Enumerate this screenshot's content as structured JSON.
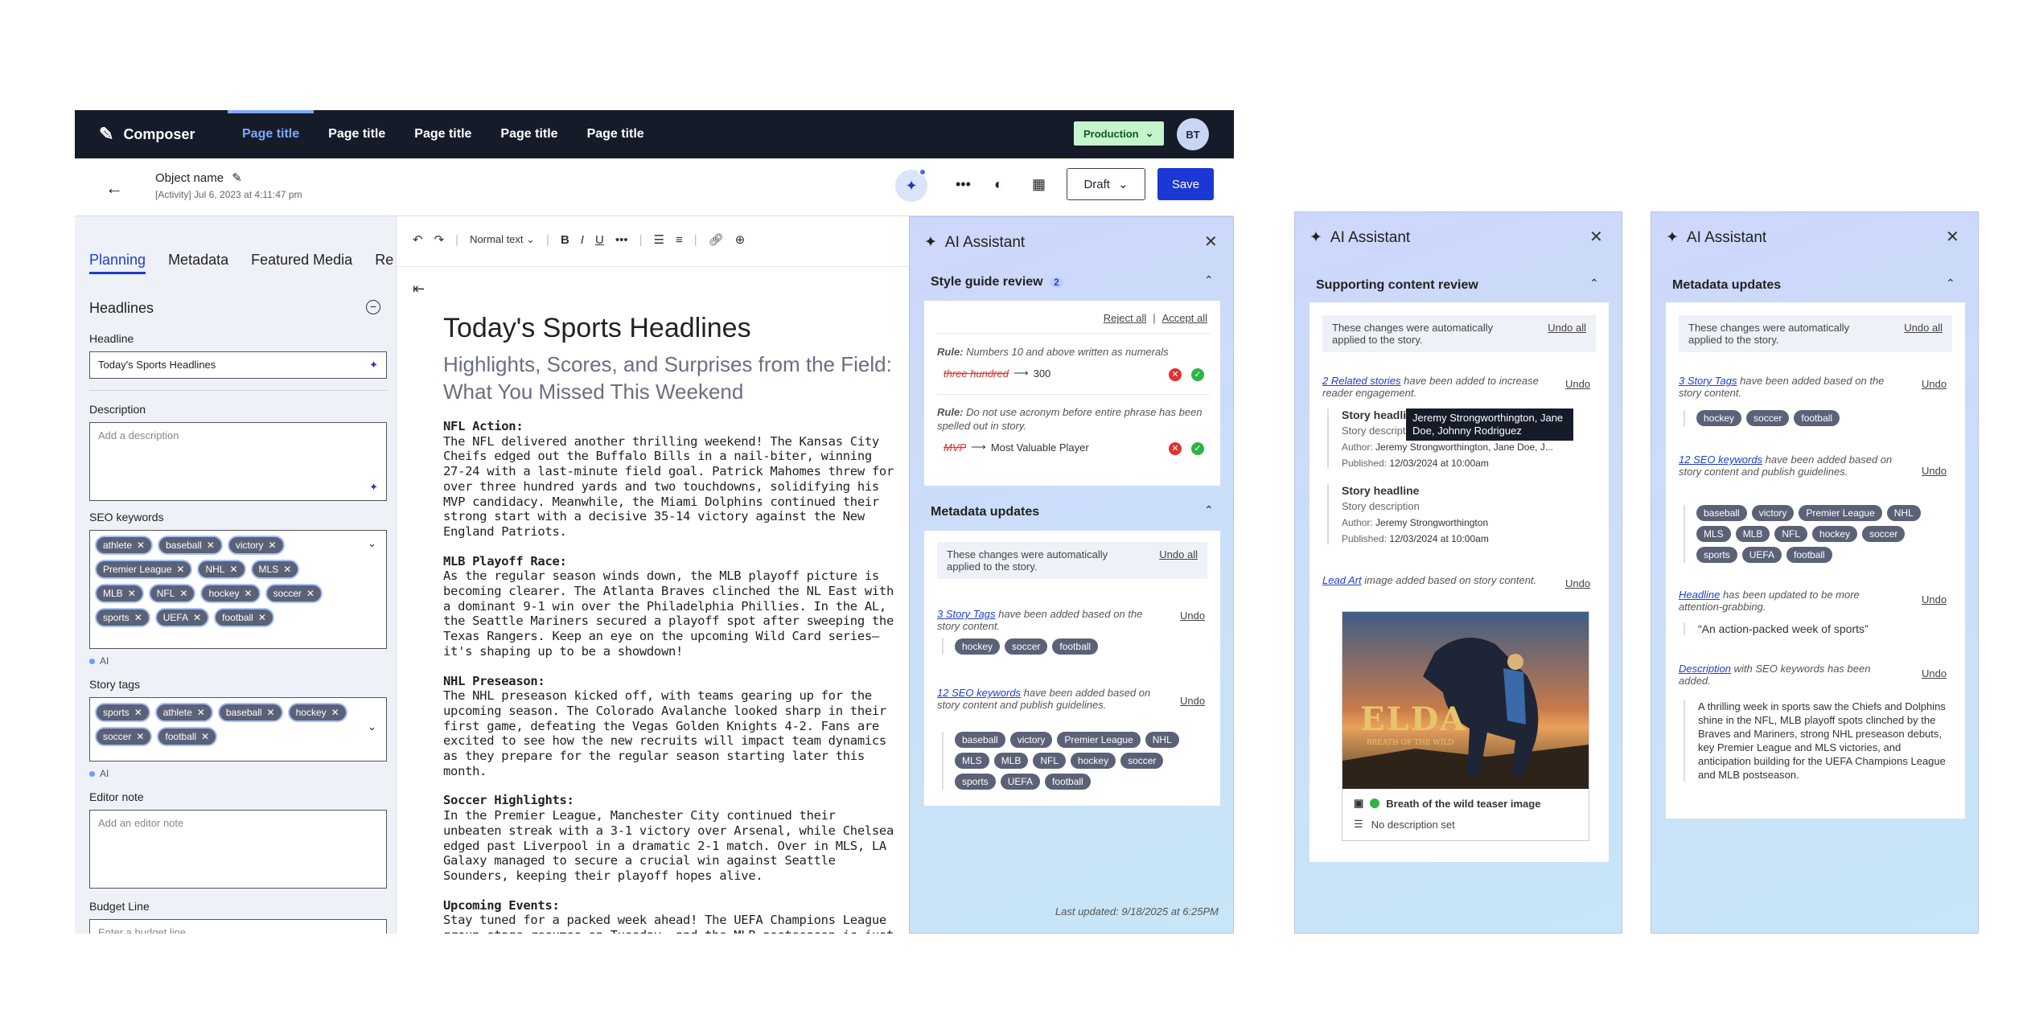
{
  "topbar": {
    "app_name": "Composer",
    "tabs": [
      "Page title",
      "Page title",
      "Page title",
      "Page title",
      "Page title"
    ],
    "environment": "Production",
    "avatar": "BT"
  },
  "subbar": {
    "object_name": "Object name",
    "activity": "[Activity] Jul 6, 2023 at 4:11:47 pm",
    "status": "Draft",
    "save_label": "Save"
  },
  "left": {
    "tabs": [
      "Planning",
      "Metadata",
      "Featured Media",
      "Re"
    ],
    "section": "Headlines",
    "headline_label": "Headline",
    "headline_value": "Today's Sports Headlines",
    "description_label": "Description",
    "description_placeholder": "Add a description",
    "seo_label": "SEO keywords",
    "seo_chips": [
      "athlete",
      "baseball",
      "victory",
      "Premier League",
      "NHL",
      "MLS",
      "MLB",
      "NFL",
      "hockey",
      "soccer",
      "sports",
      "UEFA",
      "football"
    ],
    "ai_label": "AI",
    "story_tags_label": "Story tags",
    "story_tags": [
      "sports",
      "athlete",
      "baseball",
      "hockey",
      "soccer",
      "football"
    ],
    "editor_note_label": "Editor note",
    "editor_note_placeholder": "Add an editor note",
    "budget_label": "Budget Line",
    "budget_placeholder": "Enter a budget line"
  },
  "editor": {
    "text_style": "Normal text",
    "title": "Today's Sports Headlines",
    "subtitle": "Highlights, Scores, and Surprises from the Field: What You Missed This Weekend",
    "sections": [
      {
        "heading": "NFL Action:",
        "text": "The NFL delivered another thrilling weekend! The Kansas City Cheifs edged out the Buffalo Bills in a nail-biter, winning 27-24 with a last-minute field goal. Patrick Mahomes threw for over three hundred yards and two touchdowns, solidifying his MVP candidacy. Meanwhile, the Miami Dolphins continued their strong start with a decisive 35-14 victory against the New England Patriots."
      },
      {
        "heading": "MLB Playoff Race:",
        "text": "As the regular season winds down, the MLB playoff picture is becoming clearer. The Atlanta Braves clinched the NL East with a dominant 9-1 win over the Philadelphia Phillies. In the AL, the Seattle Mariners secured a playoff spot after sweeping the Texas Rangers. Keep an eye on the upcoming Wild Card series—it's shaping up to be a showdown!"
      },
      {
        "heading": "NHL Preseason:",
        "text": "The NHL preseason kicked off, with teams gearing up for the upcoming season. The Colorado Avalanche looked sharp in their first game, defeating the Vegas Golden Knights 4-2. Fans are excited to see how the new recruits will impact team dynamics as they prepare for the regular season starting later this month."
      },
      {
        "heading": "Soccer Highlights:",
        "text": "In the Premier League, Manchester City continued their unbeaten streak with a 3-1 victory over Arsenal, while Chelsea edged past Liverpool in a dramatic 2-1 match. Over in MLS, LA Galaxy managed to secure a crucial win against Seattle Sounders, keeping their playoff hopes alive."
      },
      {
        "heading": "Upcoming Events:",
        "text": "Stay tuned for a packed week ahead! The UEFA Champions League group stage resumes on Tuesday, and the MLB postseason is just"
      }
    ]
  },
  "panel1": {
    "title": "AI Assistant",
    "style_review_title": "Style guide review",
    "style_review_count": "2",
    "reject_all": "Reject all",
    "accept_all": "Accept all",
    "rules": [
      {
        "label": "Rule:",
        "rule": "Numbers 10 and above written as numerals",
        "old": "three hundred",
        "new": "300"
      },
      {
        "label": "Rule:",
        "rule": "Do not use acronym before entire phrase has been spelled out in story.",
        "old": "MVP",
        "new": "Most Valuable Player"
      }
    ],
    "metadata_title": "Metadata updates",
    "auto_note": "These changes were automatically applied to the story.",
    "undo_all": "Undo all",
    "undo": "Undo",
    "tags_link": "3 Story Tags",
    "tags_text": " have been added based on the story content.",
    "tags": [
      "hockey",
      "soccer",
      "football"
    ],
    "seo_link": "12 SEO keywords",
    "seo_text": " have been added based on story content and publish guidelines.",
    "seo": [
      "baseball",
      "victory",
      "Premier League",
      "NHL",
      "MLS",
      "MLB",
      "NFL",
      "hockey",
      "soccer",
      "sports",
      "UEFA",
      "football"
    ],
    "last_updated": "Last updated: 9/18/2025 at 6:25PM"
  },
  "panel2": {
    "title": "AI Assistant",
    "section_title": "Supporting content review",
    "auto_note": "These changes were automatically applied to the story.",
    "undo_all": "Undo all",
    "undo": "Undo",
    "related_link": "2 Related stories",
    "related_text": " have been added to increase reader engagement.",
    "stories": [
      {
        "headline": "Story headline",
        "description": "Story description",
        "author_label": "Author:",
        "author": "Jeremy Strongworthington, Jane Doe, J...",
        "published_label": "Published:",
        "published": "12/03/2024 at 10:00am"
      },
      {
        "headline": "Story headline",
        "description": "Story description",
        "author_label": "Author:",
        "author": "Jeremy Strongworthington",
        "published_label": "Published:",
        "published": "12/03/2024 at 10:00am"
      }
    ],
    "tooltip": "Jeremy Strongworthington, Jane Doe, Johnny Rodriguez",
    "leadart_link": "Lead Art",
    "leadart_text": " image added based on story content.",
    "image_caption_title": "Breath of the wild teaser image",
    "image_caption_desc": "No description set",
    "image_logo_text": "ELDA",
    "image_logo_sub": "BREATH OF THE WILD"
  },
  "panel3": {
    "title": "AI Assistant",
    "section_title": "Metadata updates",
    "auto_note": "These changes were automatically applied to the story.",
    "undo_all": "Undo all",
    "undo": "Undo",
    "tags_link": "3 Story Tags",
    "tags_text": " have been added based on the story content.",
    "tags": [
      "hockey",
      "soccer",
      "football"
    ],
    "seo_link": "12 SEO keywords",
    "seo_text": " have been added based on story content and publish guidelines.",
    "seo": [
      "baseball",
      "victory",
      "Premier League",
      "NHL",
      "MLS",
      "MLB",
      "NFL",
      "hockey",
      "soccer",
      "sports",
      "UEFA",
      "football"
    ],
    "headline_link": "Headline",
    "headline_text": " has been updated to be more attention-grabbing.",
    "headline_value": "“An action-packed week of sports”",
    "desc_link": "Description",
    "desc_text": " with SEO keywords has been added.",
    "desc_value": "A thrilling week in sports saw the Chiefs and Dolphins shine in the NFL, MLB playoff spots clinched by the Braves and Mariners, strong NHL preseason debuts, key Premier League and MLS victories, and anticipation building for the UEFA Champions League and MLB postseason."
  }
}
